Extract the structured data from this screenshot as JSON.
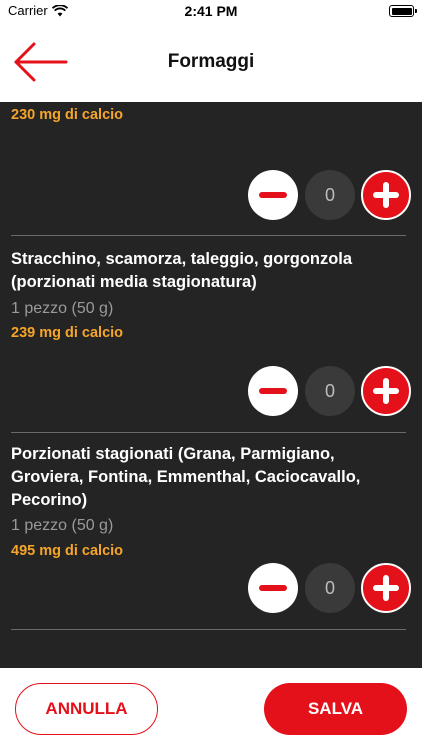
{
  "status_bar": {
    "carrier": "Carrier",
    "time": "2:41 PM",
    "icons": [
      "wifi-icon",
      "battery-icon"
    ]
  },
  "nav": {
    "title": "Formaggi",
    "back_icon": "arrow-left-icon"
  },
  "items": [
    {
      "name": "",
      "portion": "",
      "calcium": "230 mg di calcio",
      "quantity": "0"
    },
    {
      "name": "Stracchino, scamorza, taleggio, gorgonzola (porzionati media stagionatura)",
      "portion": "1 pezzo (50 g)",
      "calcium": "239 mg di calcio",
      "quantity": "0"
    },
    {
      "name": "Porzionati stagionati (Grana, Parmigiano, Groviera, Fontina, Emmenthal, Caciocavallo, Pecorino)",
      "portion": "1 pezzo (50 g)",
      "calcium": "495 mg di calcio",
      "quantity": "0"
    }
  ],
  "footer": {
    "cancel_label": "ANNULLA",
    "save_label": "SALVA"
  },
  "colors": {
    "accent": "#e4101a",
    "calcium_text": "#f5a52a",
    "content_bg": "#252424",
    "portion_text": "#9a9a9a"
  }
}
